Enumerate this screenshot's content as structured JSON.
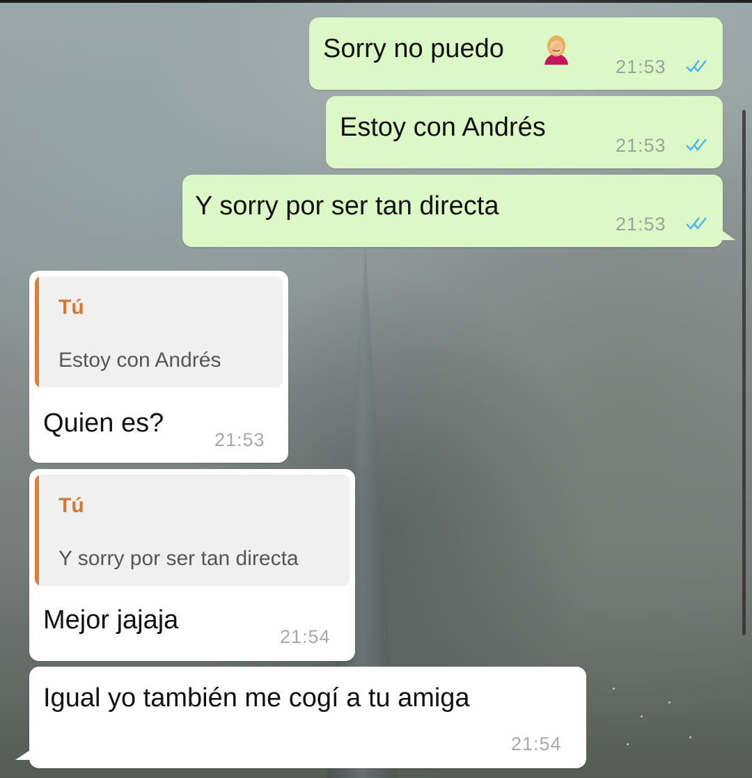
{
  "conversation": {
    "outgoing": [
      {
        "text": "Sorry no puedo",
        "emoji": "woman-facepalming-icon",
        "time": "21:53",
        "status": "read"
      },
      {
        "text": "Estoy con Andrés",
        "time": "21:53",
        "status": "read"
      },
      {
        "text": "Y sorry por ser tan directa",
        "time": "21:53",
        "status": "read"
      }
    ],
    "incoming": [
      {
        "quote_author": "Tú",
        "quote_text": "Estoy con Andrés",
        "text": "Quien es?",
        "time": "21:53"
      },
      {
        "quote_author": "Tú",
        "quote_text": "Y sorry por ser tan directa",
        "text": "Mejor jajaja",
        "time": "21:54"
      },
      {
        "text": "Igual yo también me cogí a tu amiga",
        "time": "21:54"
      }
    ]
  },
  "colors": {
    "outgoing_bubble": "#dcf8c6",
    "incoming_bubble": "#ffffff",
    "quote_accent": "#d9823b",
    "read_ticks": "#4fb6ec"
  }
}
